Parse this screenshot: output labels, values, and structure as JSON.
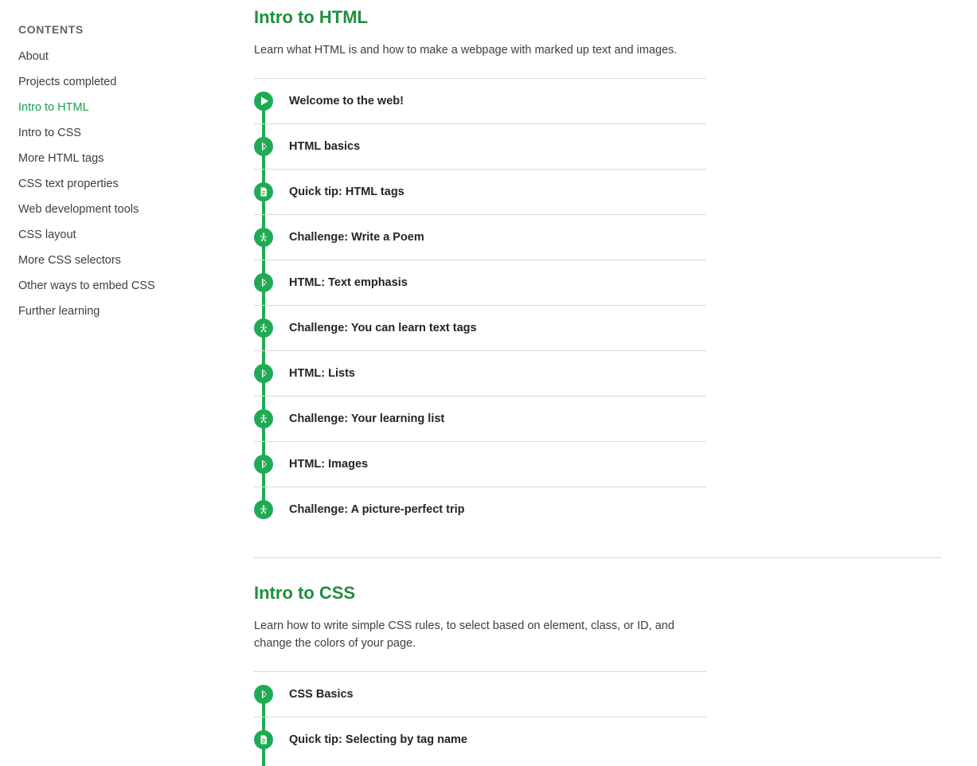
{
  "sidebar": {
    "heading": "CONTENTS",
    "items": [
      {
        "label": "About"
      },
      {
        "label": "Projects completed"
      },
      {
        "label": "Intro to HTML",
        "active": true
      },
      {
        "label": "Intro to CSS"
      },
      {
        "label": "More HTML tags"
      },
      {
        "label": "CSS text properties"
      },
      {
        "label": "Web development tools"
      },
      {
        "label": "CSS layout"
      },
      {
        "label": "More CSS selectors"
      },
      {
        "label": "Other ways to embed CSS"
      },
      {
        "label": "Further learning"
      }
    ]
  },
  "sections": [
    {
      "title": "Intro to HTML",
      "description": "Learn what HTML is and how to make a webpage with marked up text and images.",
      "items": [
        {
          "label": "Welcome to the web!",
          "icon": "play-icon"
        },
        {
          "label": "HTML basics",
          "icon": "talkthrough-icon"
        },
        {
          "label": "Quick tip: HTML tags",
          "icon": "document-icon"
        },
        {
          "label": "Challenge: Write a Poem",
          "icon": "challenge-icon"
        },
        {
          "label": "HTML: Text emphasis",
          "icon": "talkthrough-icon"
        },
        {
          "label": "Challenge: You can learn text tags",
          "icon": "challenge-icon"
        },
        {
          "label": "HTML: Lists",
          "icon": "talkthrough-icon"
        },
        {
          "label": "Challenge: Your learning list",
          "icon": "challenge-icon"
        },
        {
          "label": "HTML: Images",
          "icon": "talkthrough-icon"
        },
        {
          "label": "Challenge: A picture-perfect trip",
          "icon": "challenge-icon"
        }
      ]
    },
    {
      "title": "Intro to CSS",
      "description": "Learn how to write simple CSS rules, to select based on element, class, or ID, and change the colors of your page.",
      "items": [
        {
          "label": "CSS Basics",
          "icon": "talkthrough-icon"
        },
        {
          "label": "Quick tip: Selecting by tag name",
          "icon": "document-icon"
        }
      ]
    }
  ],
  "colors": {
    "accent": "#1fab54",
    "heading": "#1f8f3f",
    "active_link": "#1f9e46"
  }
}
